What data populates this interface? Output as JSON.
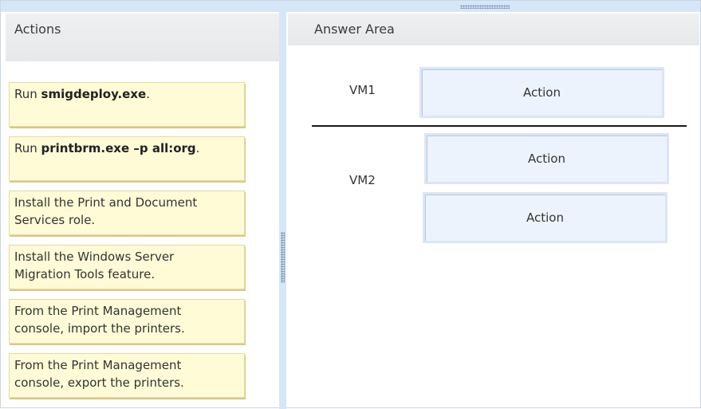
{
  "left_panel": {
    "title": "Actions",
    "items": [
      {
        "prefix": "Run ",
        "bold": "smigdeploy.exe",
        "suffix": "."
      },
      {
        "prefix": "Run ",
        "bold": "printbrm.exe –p all:org",
        "suffix": "."
      },
      {
        "line1": "Install the Print and Document",
        "line2": "Services role."
      },
      {
        "line1": "Install the Windows Server",
        "line2": "Migration Tools feature."
      },
      {
        "line1": "From the Print Management",
        "line2": "console, import the printers."
      },
      {
        "line1": "From the Print Management",
        "line2": "console, export the printers."
      }
    ]
  },
  "right_panel": {
    "title": "Answer Area",
    "vm1_label": "VM1",
    "vm2_label": "VM2",
    "slots": [
      "Action",
      "Action",
      "Action"
    ]
  }
}
